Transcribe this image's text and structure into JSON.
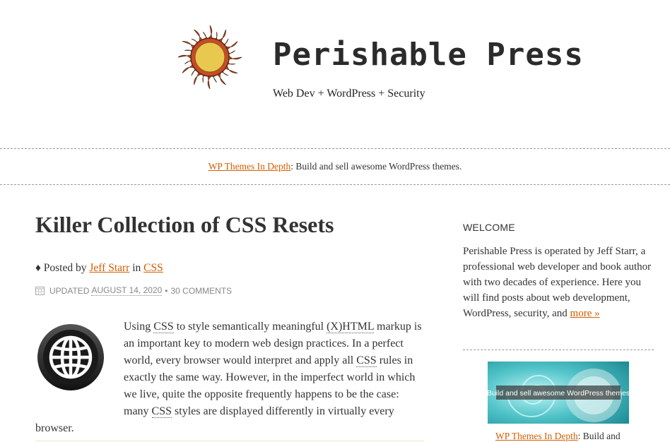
{
  "header": {
    "site_title": "Perishable Press",
    "tagline": "Web Dev + WordPress + Security"
  },
  "promo": {
    "link": "WP Themes In Depth",
    "text": ": Build and sell awesome WordPress themes."
  },
  "post": {
    "title": "Killer Collection of CSS Resets",
    "byline_prefix": "♦ Posted by",
    "author": "Jeff Starr",
    "in_word": "in",
    "category": "CSS",
    "meta_updated": "UPDATED",
    "meta_date": "AUGUST 14, 2020",
    "meta_sep": "•",
    "meta_comments": "30 COMMENTS",
    "icon": "globe-icon",
    "excerpt": {
      "t1": "Using ",
      "a1": "CSS",
      "t2": " to style semantically meaningful ",
      "a2": "(X)HTML",
      "t3": " markup is an important key to modern web design practices. In a perfect world, every browser would interpret and apply all ",
      "a3": "CSS",
      "t4": " rules in exactly the same way. However, in the imperfect world in which we live, quite the opposite frequently happens to be the case: many ",
      "a4": "CSS",
      "t5": " styles are displayed differently in virtually every browser."
    }
  },
  "sidebar": {
    "heading": "WELCOME",
    "welcome_text": "Perishable Press is operated by Jeff Starr, a professional web developer and book author with two decades of experience. Here you will find posts about web development, WordPress, security, and ",
    "more_link": "more »",
    "ad_banner_text": "Build and sell awesome WordPress themes",
    "ad_link": "WP Themes In Depth",
    "ad_text": ": Build and"
  },
  "colors": {
    "link": "#d35d00",
    "text": "#333333",
    "sun_outer": "#c94a2a",
    "sun_inner": "#e8c84f"
  }
}
